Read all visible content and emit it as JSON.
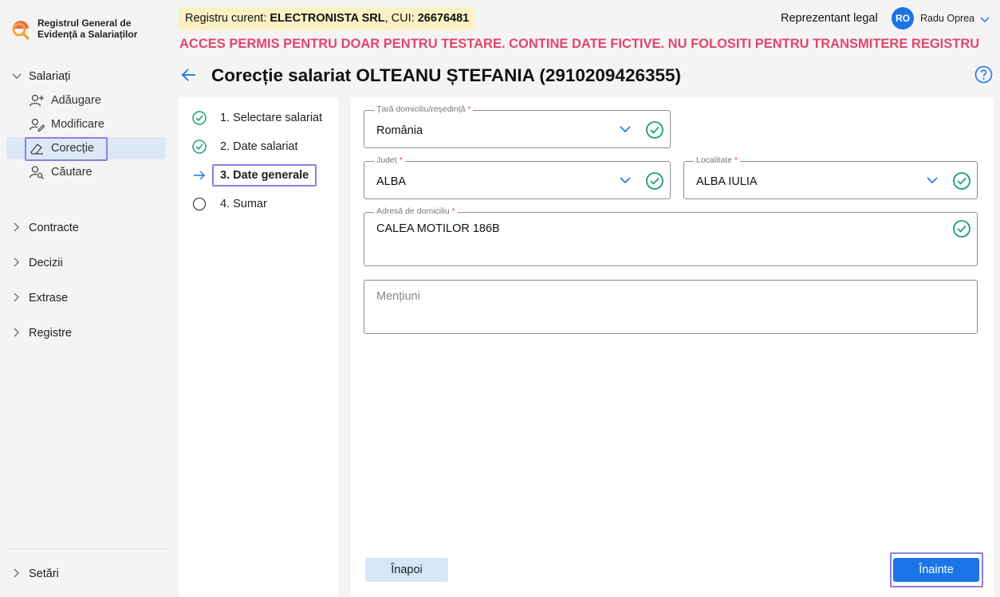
{
  "app": {
    "title_line1": "Registrul General de",
    "title_line2": "Evidență a Salariaților"
  },
  "header": {
    "registry_prefix": "Registru curent: ",
    "company": "ELECTRONISTA SRL",
    "cui_prefix": ", CUI: ",
    "cui": "26676481",
    "warning": "ACCES PERMIS PENTRU DOAR PENTRU TESTARE. CONTINE DATE FICTIVE. NU FOLOSITI PENTRU TRANSMITERE REGISTRU",
    "role": "Reprezentant legal",
    "avatar_initials": "RO",
    "user_name": "Radu Oprea"
  },
  "sidebar": {
    "groups": [
      {
        "label": "Salariați",
        "expanded": true
      },
      {
        "label": "Contracte"
      },
      {
        "label": "Decizii"
      },
      {
        "label": "Extrase"
      },
      {
        "label": "Registre"
      }
    ],
    "sub_items": [
      {
        "label": "Adăugare",
        "icon": "user-plus-icon"
      },
      {
        "label": "Modificare",
        "icon": "user-edit-icon"
      },
      {
        "label": "Corecție",
        "icon": "eraser-icon",
        "active": true
      },
      {
        "label": "Căutare",
        "icon": "user-search-icon"
      }
    ],
    "settings": "Setări"
  },
  "page": {
    "title": "Corecție salariat OLTEANU  ȘTEFANIA (2910209426355)"
  },
  "steps": [
    {
      "label": "1. Selectare salariat",
      "status": "done"
    },
    {
      "label": "2. Date salariat",
      "status": "done"
    },
    {
      "label": "3. Date generale",
      "status": "current"
    },
    {
      "label": "4. Sumar",
      "status": "pending"
    }
  ],
  "form": {
    "country": {
      "label": "Țară domiciliu/reședință",
      "value": "România"
    },
    "county": {
      "label": "Județ",
      "value": "ALBA"
    },
    "locality": {
      "label": "Localitate",
      "value": "ALBA IULIA"
    },
    "address": {
      "label": "Adresă de domiciliu",
      "value": "CALEA MOTILOR 186B"
    },
    "mentions": {
      "placeholder": "Mențiuni"
    },
    "required_mark": "*"
  },
  "buttons": {
    "back": "Înapoi",
    "next": "Înainte"
  },
  "colors": {
    "accent": "#1b74e8",
    "success": "#1aa06d",
    "warning": "#e2466a",
    "highlight": "#8a7fe6"
  }
}
